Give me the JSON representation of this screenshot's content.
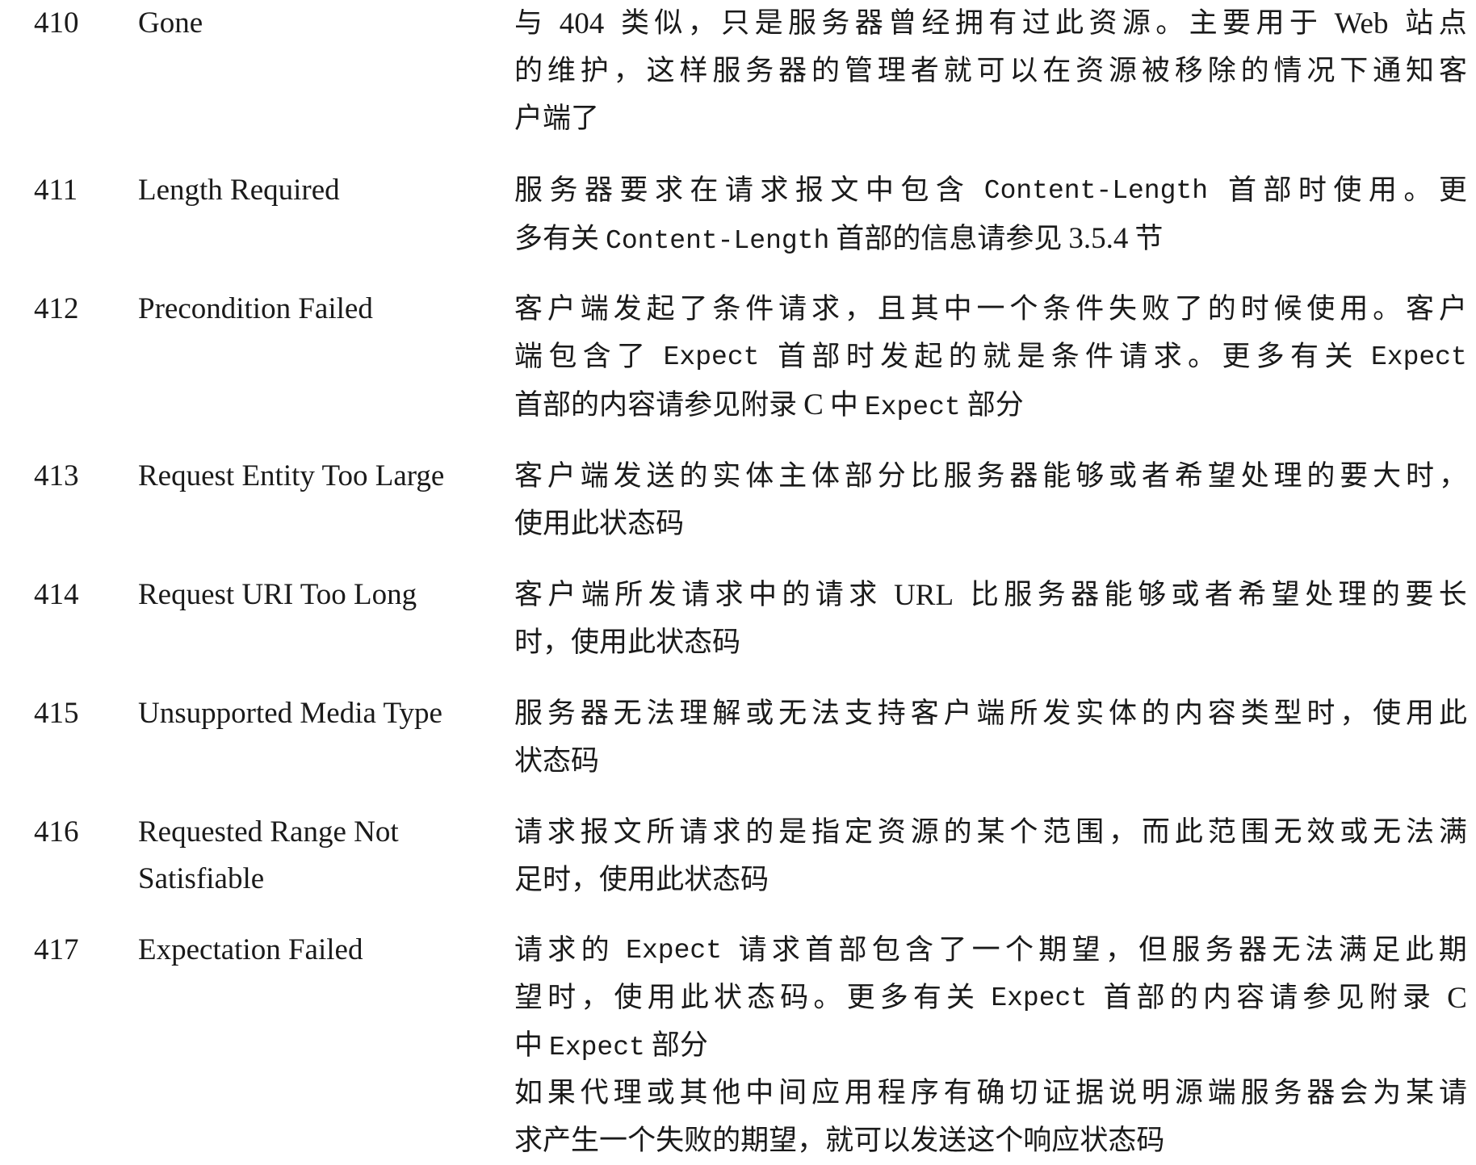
{
  "rows": [
    {
      "code": "410",
      "name": [
        "Gone"
      ],
      "desc": [
        [
          "与 ",
          "404",
          " 类似，只是服务器曾经拥有过此资源。主要用于 ",
          "Web",
          " 站点"
        ],
        [
          "的维护，这样服务器的管理者就可以在资源被移除的情况下通知客"
        ],
        [
          "户端了"
        ]
      ]
    },
    {
      "code": "411",
      "name": [
        "Length Required"
      ],
      "desc": [
        [
          "服务器要求在请求报文中包含 ",
          "Content-Length",
          " 首部时使用。更"
        ],
        [
          "多有关 ",
          "Content-Length",
          " 首部的信息请参见 ",
          "3.5.4",
          " 节"
        ]
      ]
    },
    {
      "code": "412",
      "name": [
        "Precondition Failed"
      ],
      "desc": [
        [
          "客户端发起了条件请求，且其中一个条件失败了的时候使用。客户"
        ],
        [
          "端包含了 ",
          "Expect",
          " 首部时发起的就是条件请求。更多有关 ",
          "Expect"
        ],
        [
          "首部的内容请参见附录 ",
          "C",
          " 中 ",
          "Expect",
          " 部分"
        ]
      ]
    },
    {
      "code": "413",
      "name": [
        "Request Entity Too Large"
      ],
      "desc": [
        [
          "客户端发送的实体主体部分比服务器能够或者希望处理的要大时，"
        ],
        [
          "使用此状态码"
        ]
      ]
    },
    {
      "code": "414",
      "name": [
        "Request URI Too Long"
      ],
      "desc": [
        [
          "客户端所发请求中的请求 ",
          "URL",
          " 比服务器能够或者希望处理的要长"
        ],
        [
          "时，使用此状态码"
        ]
      ]
    },
    {
      "code": "415",
      "name": [
        "Unsupported Media Type"
      ],
      "desc": [
        [
          "服务器无法理解或无法支持客户端所发实体的内容类型时，使用此"
        ],
        [
          "状态码"
        ]
      ]
    },
    {
      "code": "416",
      "name": [
        "Requested Range Not",
        "Satisfiable"
      ],
      "desc": [
        [
          "请求报文所请求的是指定资源的某个范围，而此范围无效或无法满"
        ],
        [
          "足时，使用此状态码"
        ]
      ]
    },
    {
      "code": "417",
      "name": [
        "Expectation Failed"
      ],
      "desc": [
        [
          "请求的 ",
          "Expect",
          " 请求首部包含了一个期望，但服务器无法满足此期"
        ],
        [
          "望时，使用此状态码。更多有关 ",
          "Expect",
          " 首部的内容请参见附录 ",
          "C"
        ],
        [
          "中 ",
          "Expect",
          " 部分"
        ],
        [
          "如果代理或其他中间应用程序有确切证据说明源端服务器会为某请"
        ],
        [
          "求产生一个失败的期望，就可以发送这个响应状态码"
        ]
      ]
    }
  ]
}
